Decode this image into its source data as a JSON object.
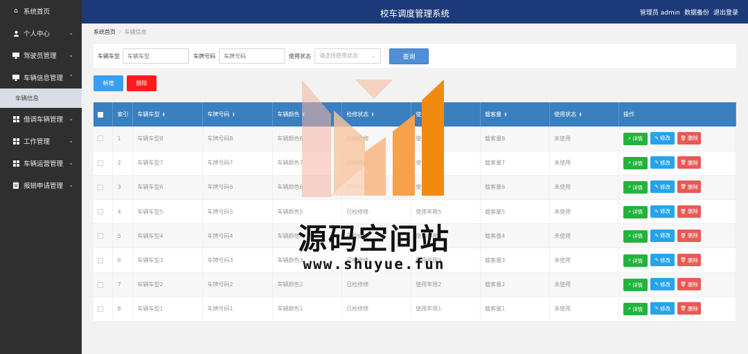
{
  "app_title": "校车调度管理系统",
  "top_links": [
    "管理员 admin",
    "数据备份",
    "退出登录"
  ],
  "sidebar": {
    "items": [
      {
        "label": "系统首页",
        "icon": "home-icon",
        "has_children": false
      },
      {
        "label": "个人中心",
        "icon": "user-icon",
        "has_children": true
      },
      {
        "label": "驾驶员管理",
        "icon": "monitor-icon",
        "has_children": true
      },
      {
        "label": "车辆信息管理",
        "icon": "monitor-icon",
        "has_children": true,
        "expanded": true,
        "children": [
          "车辆信息"
        ]
      },
      {
        "label": "借调车辆管理",
        "icon": "grid-icon",
        "has_children": true
      },
      {
        "label": "工作管理",
        "icon": "grid-icon",
        "has_children": true
      },
      {
        "label": "车辆运营管理",
        "icon": "grid-icon",
        "has_children": true
      },
      {
        "label": "报销申请管理",
        "icon": "clipboard-icon",
        "has_children": true
      }
    ]
  },
  "breadcrumb": {
    "home": "系统首页",
    "current": "车辆信息"
  },
  "search": {
    "vehicle_type_label": "车辆车型",
    "vehicle_type_placeholder": "车辆车型",
    "plate_label": "车牌号码",
    "plate_placeholder": "车牌号码",
    "status_label": "使用状态",
    "status_placeholder": "请选择使用状态",
    "query_button": "查询"
  },
  "actions": {
    "add": "新增",
    "delete": "删除"
  },
  "table": {
    "columns": [
      "索引",
      "车辆车型",
      "车牌号码",
      "车辆颜色",
      "检修状态",
      "使用年限",
      "载客量",
      "使用状态",
      "操作"
    ],
    "row_actions": {
      "detail": "详情",
      "edit": "修改",
      "delete": "删除"
    },
    "rows": [
      {
        "index": "1",
        "type": "车辆车型8",
        "plate": "车牌号码8",
        "color": "车辆颜色8",
        "repair": "已检修修",
        "years": "使用年限8",
        "capacity": "载客量8",
        "status": "未使用"
      },
      {
        "index": "2",
        "type": "车辆车型7",
        "plate": "车牌号码7",
        "color": "车辆颜色7",
        "repair": "已检修修",
        "years": "使用年限7",
        "capacity": "载客量7",
        "status": "未使用"
      },
      {
        "index": "3",
        "type": "车辆车型6",
        "plate": "车牌号码6",
        "color": "车辆颜色6",
        "repair": "已检修修",
        "years": "使用年限6",
        "capacity": "载客量6",
        "status": "未使用"
      },
      {
        "index": "4",
        "type": "车辆车型5",
        "plate": "车牌号码5",
        "color": "车辆颜色5",
        "repair": "已检修修",
        "years": "使用年限5",
        "capacity": "载客量5",
        "status": "未使用"
      },
      {
        "index": "5",
        "type": "车辆车型4",
        "plate": "车牌号码4",
        "color": "车辆颜色4",
        "repair": "已检修修",
        "years": "使用年限4",
        "capacity": "载客量4",
        "status": "未使用"
      },
      {
        "index": "6",
        "type": "车辆车型3",
        "plate": "车牌号码3",
        "color": "车辆颜色3",
        "repair": "已检修修",
        "years": "使用年限3",
        "capacity": "载客量3",
        "status": "未使用"
      },
      {
        "index": "7",
        "type": "车辆车型2",
        "plate": "车牌号码2",
        "color": "车辆颜色2",
        "repair": "已检修修",
        "years": "使用年限2",
        "capacity": "载客量2",
        "status": "未使用"
      },
      {
        "index": "8",
        "type": "车辆车型1",
        "plate": "车牌号码1",
        "color": "车辆颜色1",
        "repair": "已检修修",
        "years": "使用年限1",
        "capacity": "载客量1",
        "status": "未使用"
      }
    ]
  },
  "watermark": {
    "title": "源码空间站",
    "url": "www.shuyue.fun"
  },
  "colors": {
    "header": "#1c3a7a",
    "sidebar": "#2f2f2f",
    "table_header": "#3a7fc0",
    "add": "#3a9ff0",
    "delete": "#ff1b1b",
    "detail": "#23b33c",
    "edit": "#26a4e8",
    "row_delete": "#e85a54",
    "logo_orange": "#f7931e"
  }
}
